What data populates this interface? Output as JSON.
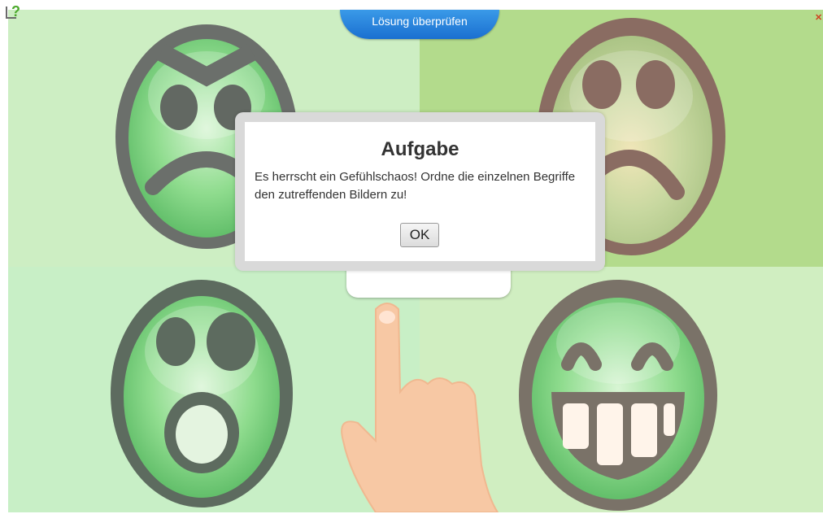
{
  "toolbar": {
    "check_label": "Lösung überprüfen",
    "help_icon": "help-icon",
    "close_icon": "close-icon"
  },
  "dialog": {
    "title": "Aufgabe",
    "text": "Es herrscht ein Gefühlschaos! Ordne die einzelnen Begriffe den zutreffenden Bildern zu!",
    "ok_label": "OK"
  },
  "images": [
    {
      "name": "angry-smiley"
    },
    {
      "name": "sad-smiley"
    },
    {
      "name": "surprised-smiley"
    },
    {
      "name": "grinning-smiley"
    },
    {
      "name": "pointing-hand"
    }
  ],
  "colors": {
    "button_blue": "#2a82dc",
    "face_green": "#6ed07a",
    "outline_gray": "#6b6f6b",
    "outline_brown": "#8a6c62"
  }
}
